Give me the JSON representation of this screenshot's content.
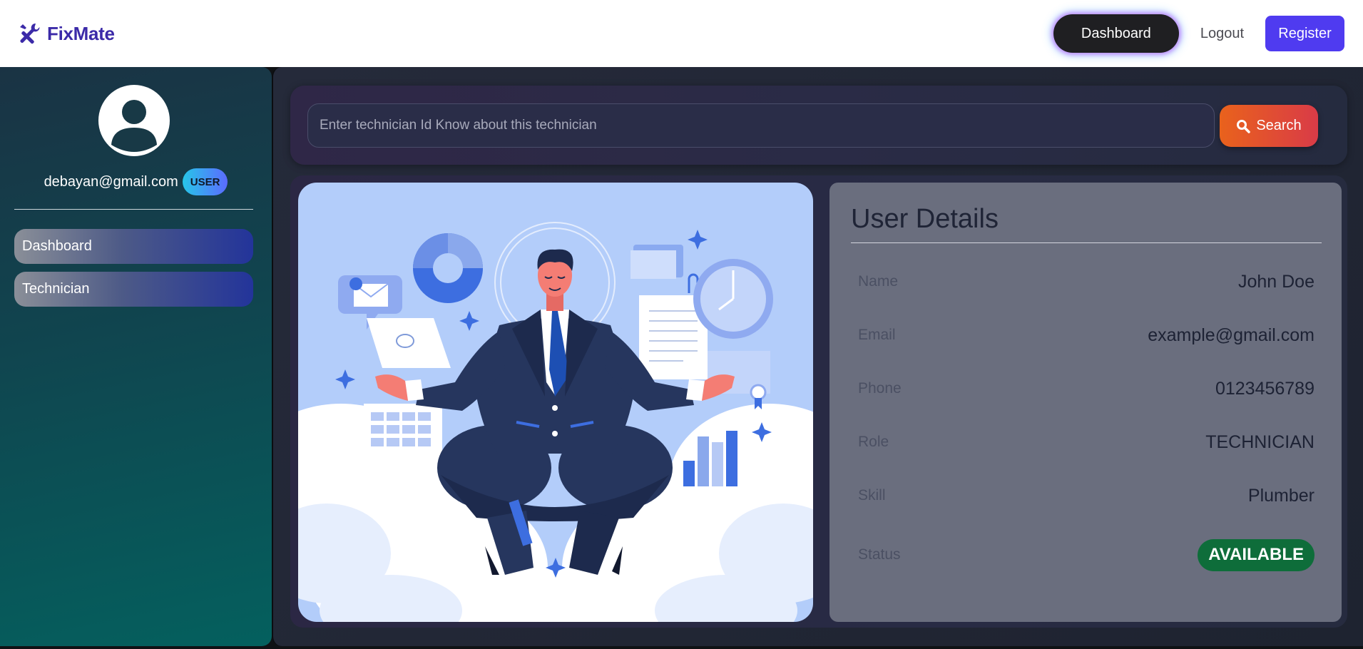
{
  "app": {
    "brand": "FixMate",
    "brand_icon": "tools-icon"
  },
  "nav": {
    "dashboard": "Dashboard",
    "logout": "Logout",
    "register": "Register"
  },
  "sidebar": {
    "email": "debayan@gmail.com",
    "role": "USER",
    "items": [
      {
        "label": "Dashboard"
      },
      {
        "label": "Technician"
      }
    ]
  },
  "search": {
    "placeholder": "Enter technician Id Know about this technician",
    "button": "Search"
  },
  "details": {
    "title": "User Details",
    "rows": [
      {
        "label": "Name",
        "value": "John Doe"
      },
      {
        "label": "Email",
        "value": "example@gmail.com"
      },
      {
        "label": "Phone",
        "value": "0123456789"
      },
      {
        "label": "Role",
        "value": "TECHNICIAN"
      },
      {
        "label": "Skill",
        "value": "Plumber"
      },
      {
        "label": "Status",
        "value": "AVAILABLE"
      }
    ]
  },
  "colors": {
    "brand": "#3b2aa8",
    "register_button": "#4f3bf0",
    "status_available": "#0e6d3a",
    "search_button_start": "#e9621c",
    "search_button_end": "#d93b47"
  }
}
